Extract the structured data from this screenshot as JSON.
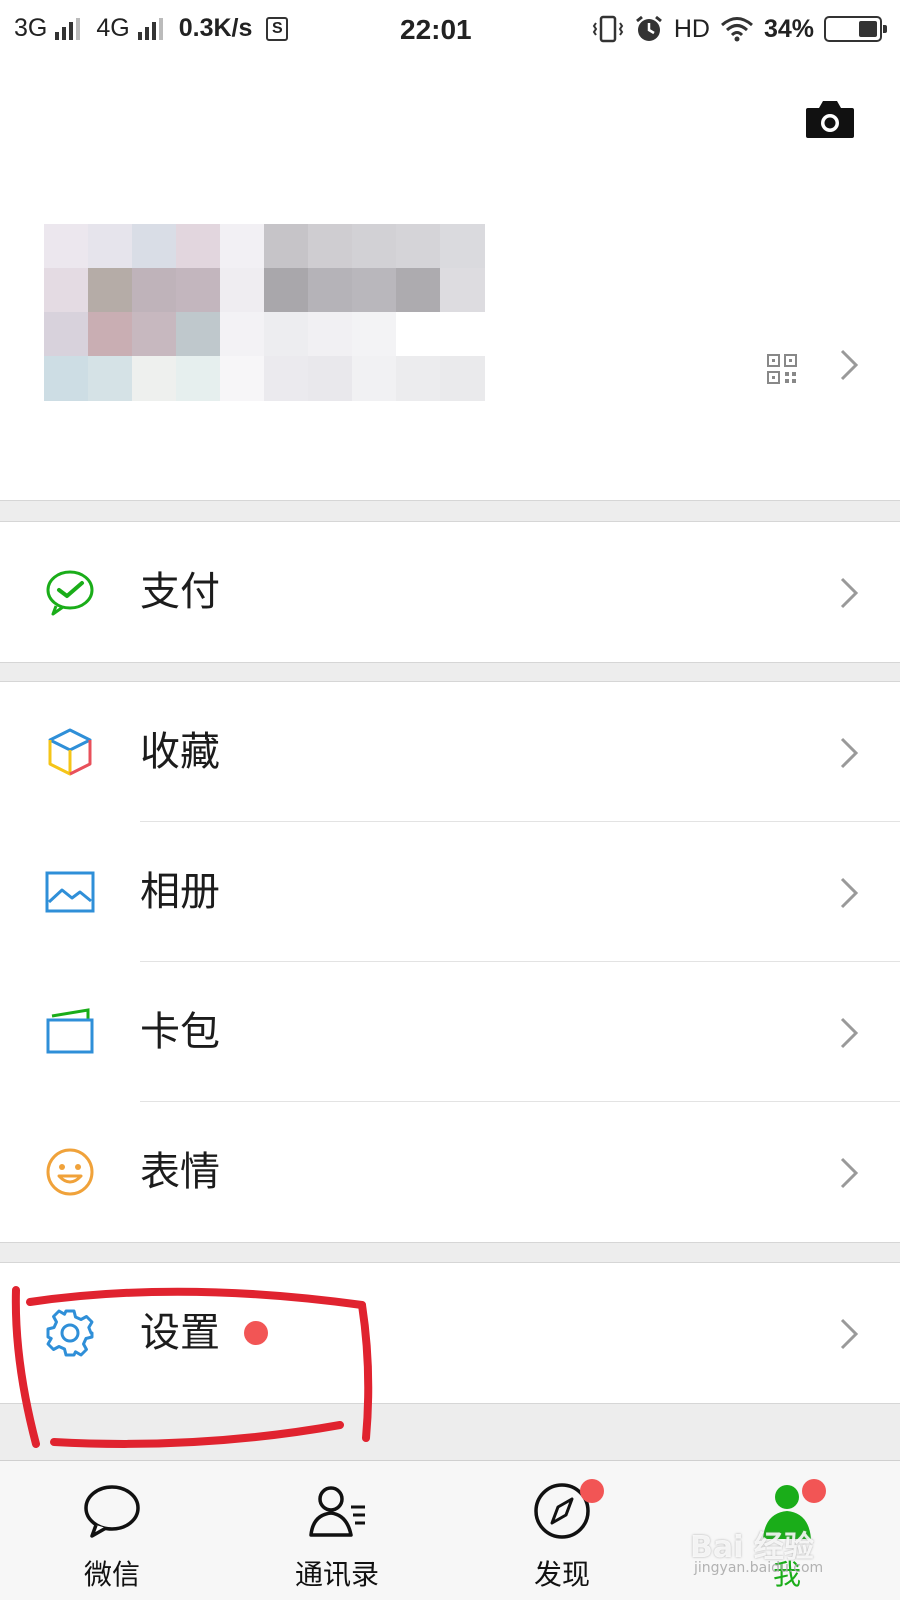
{
  "status_bar": {
    "net1": "3G",
    "net2": "4G",
    "speed": "0.3K/s",
    "s_badge": "S",
    "time": "22:01",
    "hd": "HD",
    "battery": "34%",
    "battery_level": 0.34
  },
  "profile": {
    "camera_icon": "camera-icon",
    "qr_icon": "qr-code-icon",
    "name_blurred": true
  },
  "menu": {
    "pay": {
      "label": "支付",
      "icon": "wechat-pay-icon",
      "color": "#1aad19"
    },
    "favorites": {
      "label": "收藏",
      "icon": "cube-icon"
    },
    "album": {
      "label": "相册",
      "icon": "photo-album-icon",
      "color": "#2f8fd8"
    },
    "cards": {
      "label": "卡包",
      "icon": "card-wallet-icon",
      "color": "#2f8fd8"
    },
    "stickers": {
      "label": "表情",
      "icon": "smiley-icon",
      "color": "#f0a23a"
    },
    "settings": {
      "label": "设置",
      "icon": "gear-icon",
      "color": "#2f8fd8",
      "has_badge": true
    }
  },
  "tabs": [
    {
      "label": "微信",
      "icon": "chat-bubble-icon",
      "badge": false
    },
    {
      "label": "通讯录",
      "icon": "contacts-icon",
      "badge": false
    },
    {
      "label": "发现",
      "icon": "compass-icon",
      "badge": true
    },
    {
      "label": "我",
      "icon": "person-icon",
      "badge": true,
      "active": true
    }
  ],
  "watermark": {
    "main": "Bai 经验",
    "sub": "jingyan.baidu.com"
  },
  "colors": {
    "accent": "#1aad19",
    "badge": "#f25555",
    "annotation": "#e0232f"
  }
}
